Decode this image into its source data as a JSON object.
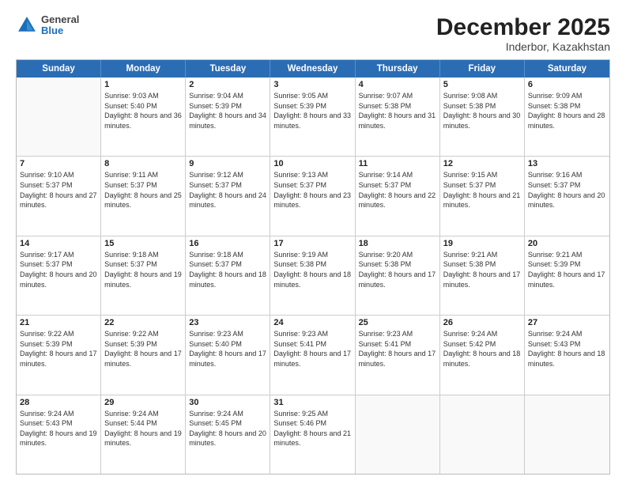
{
  "header": {
    "logo": {
      "general": "General",
      "blue": "Blue"
    },
    "title": "December 2025",
    "subtitle": "Inderbor, Kazakhstan"
  },
  "calendar": {
    "days": [
      "Sunday",
      "Monday",
      "Tuesday",
      "Wednesday",
      "Thursday",
      "Friday",
      "Saturday"
    ],
    "weeks": [
      [
        {
          "day": "",
          "sunrise": "",
          "sunset": "",
          "daylight": ""
        },
        {
          "day": "1",
          "sunrise": "Sunrise: 9:03 AM",
          "sunset": "Sunset: 5:40 PM",
          "daylight": "Daylight: 8 hours and 36 minutes."
        },
        {
          "day": "2",
          "sunrise": "Sunrise: 9:04 AM",
          "sunset": "Sunset: 5:39 PM",
          "daylight": "Daylight: 8 hours and 34 minutes."
        },
        {
          "day": "3",
          "sunrise": "Sunrise: 9:05 AM",
          "sunset": "Sunset: 5:39 PM",
          "daylight": "Daylight: 8 hours and 33 minutes."
        },
        {
          "day": "4",
          "sunrise": "Sunrise: 9:07 AM",
          "sunset": "Sunset: 5:38 PM",
          "daylight": "Daylight: 8 hours and 31 minutes."
        },
        {
          "day": "5",
          "sunrise": "Sunrise: 9:08 AM",
          "sunset": "Sunset: 5:38 PM",
          "daylight": "Daylight: 8 hours and 30 minutes."
        },
        {
          "day": "6",
          "sunrise": "Sunrise: 9:09 AM",
          "sunset": "Sunset: 5:38 PM",
          "daylight": "Daylight: 8 hours and 28 minutes."
        }
      ],
      [
        {
          "day": "7",
          "sunrise": "Sunrise: 9:10 AM",
          "sunset": "Sunset: 5:37 PM",
          "daylight": "Daylight: 8 hours and 27 minutes."
        },
        {
          "day": "8",
          "sunrise": "Sunrise: 9:11 AM",
          "sunset": "Sunset: 5:37 PM",
          "daylight": "Daylight: 8 hours and 25 minutes."
        },
        {
          "day": "9",
          "sunrise": "Sunrise: 9:12 AM",
          "sunset": "Sunset: 5:37 PM",
          "daylight": "Daylight: 8 hours and 24 minutes."
        },
        {
          "day": "10",
          "sunrise": "Sunrise: 9:13 AM",
          "sunset": "Sunset: 5:37 PM",
          "daylight": "Daylight: 8 hours and 23 minutes."
        },
        {
          "day": "11",
          "sunrise": "Sunrise: 9:14 AM",
          "sunset": "Sunset: 5:37 PM",
          "daylight": "Daylight: 8 hours and 22 minutes."
        },
        {
          "day": "12",
          "sunrise": "Sunrise: 9:15 AM",
          "sunset": "Sunset: 5:37 PM",
          "daylight": "Daylight: 8 hours and 21 minutes."
        },
        {
          "day": "13",
          "sunrise": "Sunrise: 9:16 AM",
          "sunset": "Sunset: 5:37 PM",
          "daylight": "Daylight: 8 hours and 20 minutes."
        }
      ],
      [
        {
          "day": "14",
          "sunrise": "Sunrise: 9:17 AM",
          "sunset": "Sunset: 5:37 PM",
          "daylight": "Daylight: 8 hours and 20 minutes."
        },
        {
          "day": "15",
          "sunrise": "Sunrise: 9:18 AM",
          "sunset": "Sunset: 5:37 PM",
          "daylight": "Daylight: 8 hours and 19 minutes."
        },
        {
          "day": "16",
          "sunrise": "Sunrise: 9:18 AM",
          "sunset": "Sunset: 5:37 PM",
          "daylight": "Daylight: 8 hours and 18 minutes."
        },
        {
          "day": "17",
          "sunrise": "Sunrise: 9:19 AM",
          "sunset": "Sunset: 5:38 PM",
          "daylight": "Daylight: 8 hours and 18 minutes."
        },
        {
          "day": "18",
          "sunrise": "Sunrise: 9:20 AM",
          "sunset": "Sunset: 5:38 PM",
          "daylight": "Daylight: 8 hours and 17 minutes."
        },
        {
          "day": "19",
          "sunrise": "Sunrise: 9:21 AM",
          "sunset": "Sunset: 5:38 PM",
          "daylight": "Daylight: 8 hours and 17 minutes."
        },
        {
          "day": "20",
          "sunrise": "Sunrise: 9:21 AM",
          "sunset": "Sunset: 5:39 PM",
          "daylight": "Daylight: 8 hours and 17 minutes."
        }
      ],
      [
        {
          "day": "21",
          "sunrise": "Sunrise: 9:22 AM",
          "sunset": "Sunset: 5:39 PM",
          "daylight": "Daylight: 8 hours and 17 minutes."
        },
        {
          "day": "22",
          "sunrise": "Sunrise: 9:22 AM",
          "sunset": "Sunset: 5:39 PM",
          "daylight": "Daylight: 8 hours and 17 minutes."
        },
        {
          "day": "23",
          "sunrise": "Sunrise: 9:23 AM",
          "sunset": "Sunset: 5:40 PM",
          "daylight": "Daylight: 8 hours and 17 minutes."
        },
        {
          "day": "24",
          "sunrise": "Sunrise: 9:23 AM",
          "sunset": "Sunset: 5:41 PM",
          "daylight": "Daylight: 8 hours and 17 minutes."
        },
        {
          "day": "25",
          "sunrise": "Sunrise: 9:23 AM",
          "sunset": "Sunset: 5:41 PM",
          "daylight": "Daylight: 8 hours and 17 minutes."
        },
        {
          "day": "26",
          "sunrise": "Sunrise: 9:24 AM",
          "sunset": "Sunset: 5:42 PM",
          "daylight": "Daylight: 8 hours and 18 minutes."
        },
        {
          "day": "27",
          "sunrise": "Sunrise: 9:24 AM",
          "sunset": "Sunset: 5:43 PM",
          "daylight": "Daylight: 8 hours and 18 minutes."
        }
      ],
      [
        {
          "day": "28",
          "sunrise": "Sunrise: 9:24 AM",
          "sunset": "Sunset: 5:43 PM",
          "daylight": "Daylight: 8 hours and 19 minutes."
        },
        {
          "day": "29",
          "sunrise": "Sunrise: 9:24 AM",
          "sunset": "Sunset: 5:44 PM",
          "daylight": "Daylight: 8 hours and 19 minutes."
        },
        {
          "day": "30",
          "sunrise": "Sunrise: 9:24 AM",
          "sunset": "Sunset: 5:45 PM",
          "daylight": "Daylight: 8 hours and 20 minutes."
        },
        {
          "day": "31",
          "sunrise": "Sunrise: 9:25 AM",
          "sunset": "Sunset: 5:46 PM",
          "daylight": "Daylight: 8 hours and 21 minutes."
        },
        {
          "day": "",
          "sunrise": "",
          "sunset": "",
          "daylight": ""
        },
        {
          "day": "",
          "sunrise": "",
          "sunset": "",
          "daylight": ""
        },
        {
          "day": "",
          "sunrise": "",
          "sunset": "",
          "daylight": ""
        }
      ]
    ]
  }
}
